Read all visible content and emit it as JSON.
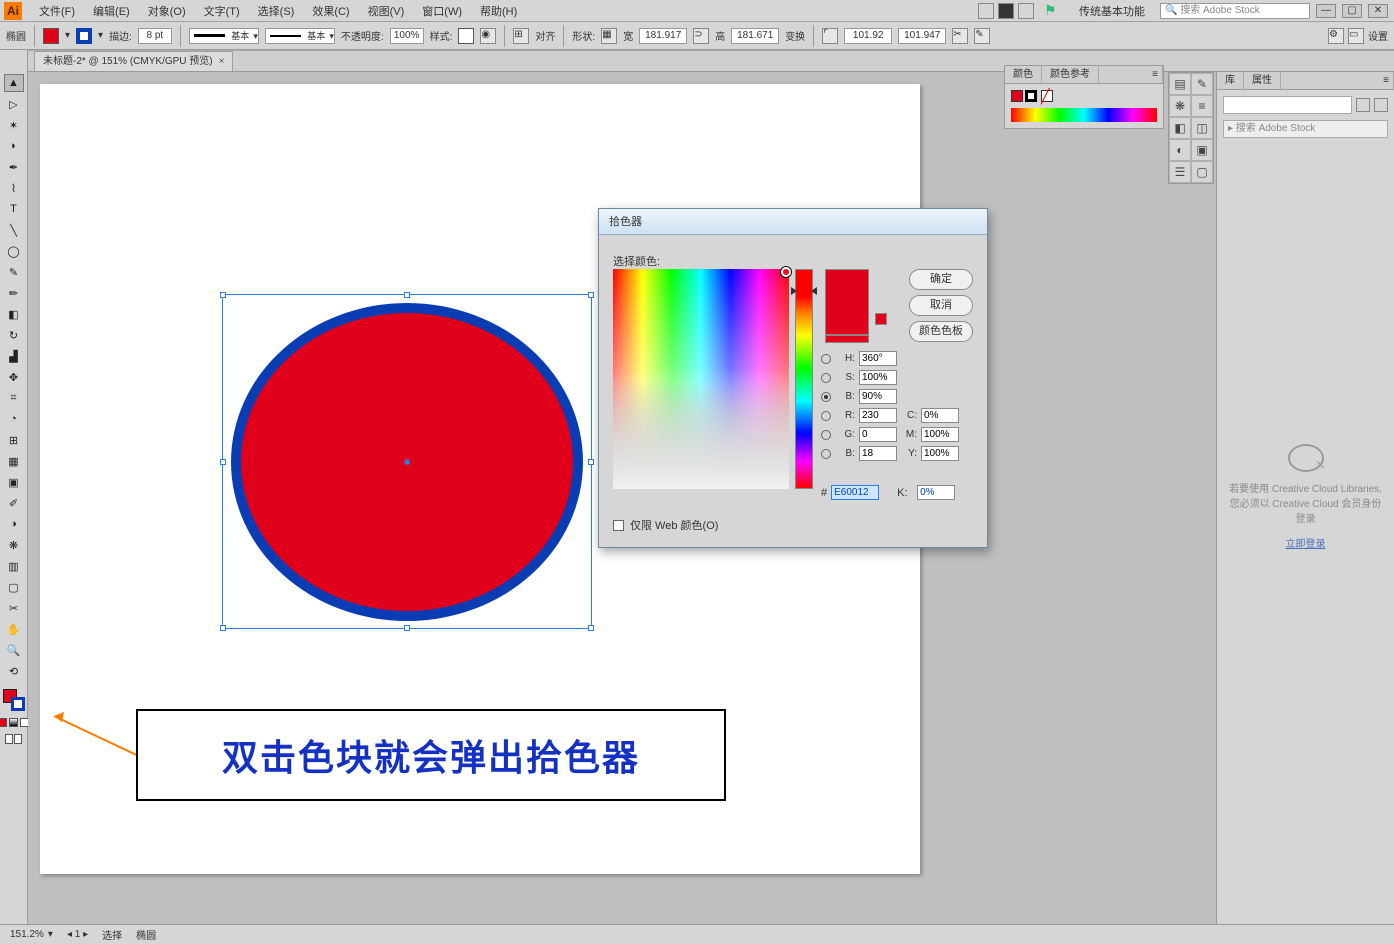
{
  "menu": {
    "items": [
      "文件(F)",
      "编辑(E)",
      "对象(O)",
      "文字(T)",
      "选择(S)",
      "效果(C)",
      "视图(V)",
      "窗口(W)",
      "帮助(H)"
    ],
    "workspace": "传统基本功能",
    "search_placeholder": "搜索 Adobe Stock"
  },
  "ctrl": {
    "left_label": "椭圆",
    "fill_color": "#e1001b",
    "stroke_color": "#0a3db3",
    "stroke_label": "描边:",
    "stroke_pt": "8 pt",
    "dash_label": "基本",
    "brush_label": "基本",
    "opacity_label": "不透明度:",
    "opacity": "100%",
    "style_label": "样式:",
    "align_label": "对齐",
    "shape_label": "形状:",
    "w_label": "宽",
    "w_val": "181.917",
    "h_label": "高",
    "h_val": "181.671",
    "transform_label": "变换",
    "x_val": "101.92",
    "y_val": "101.947",
    "setup_label": "设置"
  },
  "doc_tab": {
    "title": "未标题-2* @ 151% (CMYK/GPU 预览)",
    "close": "×"
  },
  "toolbar_icons": [
    "▲",
    "▷",
    "✶",
    "✦",
    "📷",
    "T",
    "╲",
    "◯",
    "✎",
    "✂",
    "◧",
    "◐",
    "↻",
    "▟",
    "✥",
    "⌗",
    "⊞",
    "▦",
    "▣",
    "✎",
    "✋",
    "⤢",
    "🔍",
    "⟲"
  ],
  "color_panel": {
    "tabs": [
      "颜色",
      "颜色参考"
    ],
    "fill": "#e1001b",
    "stroke": "#000000"
  },
  "dialog": {
    "title": "拾色器",
    "sub": "选择颜色:",
    "btn_ok": "确定",
    "btn_cancel": "取消",
    "btn_swatches": "颜色色板",
    "fields": {
      "H": "360°",
      "S": "100%",
      "B": "90%",
      "R": "230",
      "G": "0",
      "B2": "18",
      "C": "0%",
      "M": "100%",
      "Y": "100%",
      "K": "0%"
    },
    "hex_label": "#",
    "hex": "E60012",
    "check": "仅限 Web 颜色(O)"
  },
  "callout": "双击色块就会弹出拾色器",
  "lib": {
    "tabs": [
      "库",
      "属性"
    ],
    "search": "▸ 搜索 Adobe Stock",
    "msg1": "若要使用 Creative Cloud Libraries,",
    "msg2": "您必须以 Creative Cloud 会员身份登录",
    "link": "立即登录"
  },
  "status": {
    "zoom": "151.2%",
    "seg2": "选择",
    "seg3": "椭圆"
  }
}
